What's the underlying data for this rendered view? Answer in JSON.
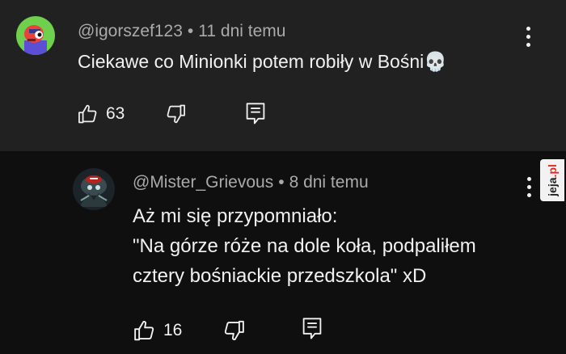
{
  "comments": [
    {
      "author": "@igorszef123",
      "time": "11 dni temu",
      "text": "Ciekawe co Minionki potem robiły w Bośni💀",
      "likes": "63",
      "avatar_icon": "cartoon-avatar-icon"
    },
    {
      "author": "@Mister_Grievous",
      "time": "8 dni temu",
      "lines": [
        "Aż mi się przypomniało:",
        "\"Na górze róże na dole koła, podpaliłem",
        "cztery bośniackie przedszkola\" xD"
      ],
      "likes": "16",
      "avatar_icon": "photo-avatar-icon"
    }
  ],
  "separator": "•",
  "watermark": {
    "text": "jeja",
    "suffix": ".pl"
  },
  "colors": {
    "top_bg": "#212121",
    "bottom_bg": "#0f0f0f",
    "text": "#f1f1f1",
    "meta": "#aaaaaa"
  }
}
